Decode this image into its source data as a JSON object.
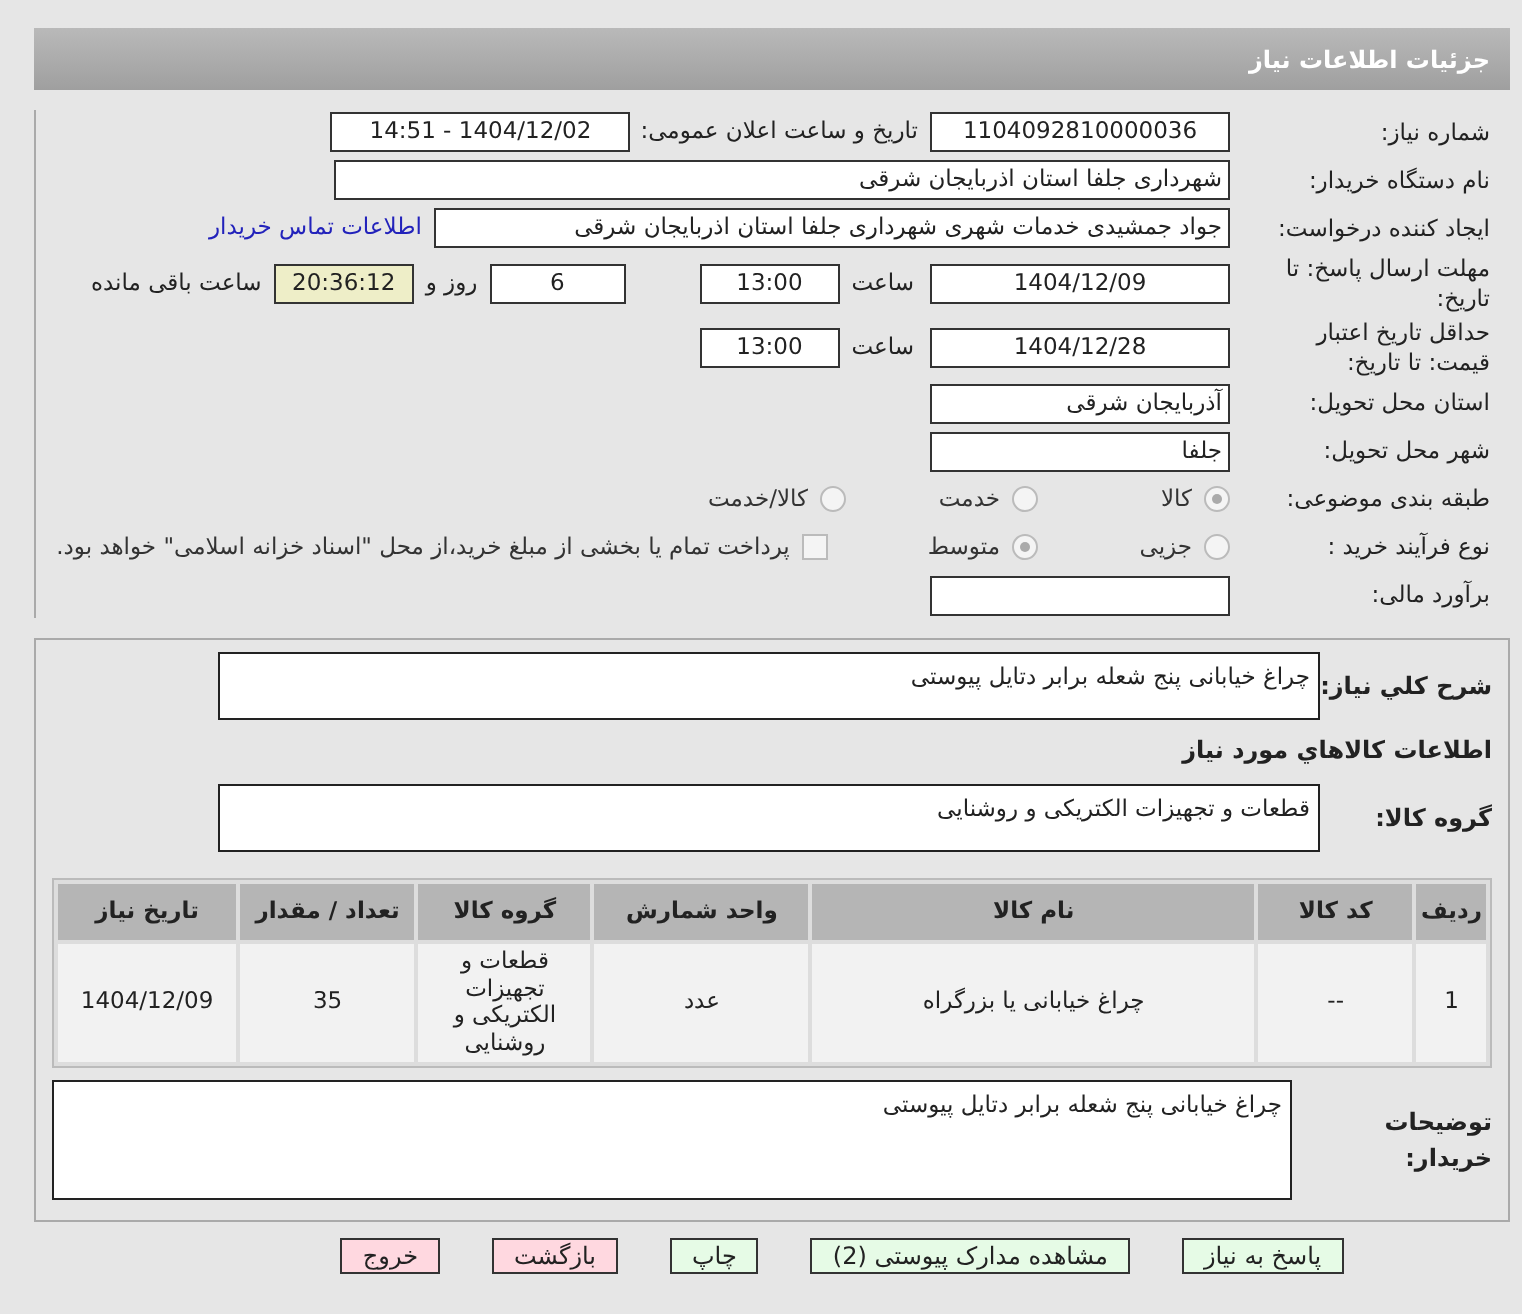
{
  "header": {
    "title": "جزئیات اطلاعات نیاز"
  },
  "need_number": {
    "label": "شماره نیاز:",
    "value": "1104092810000036"
  },
  "announce": {
    "label": "تاریخ و ساعت اعلان عمومی:",
    "value": "1404/12/02 - 14:51"
  },
  "buyer_org": {
    "label": "نام دستگاه خریدار:",
    "value": "شهرداری جلفا استان اذربایجان شرقی"
  },
  "requester": {
    "label": "ایجاد کننده درخواست:",
    "value": "جواد جمشیدی  خدمات شهری شهرداری جلفا استان اذربایجان شرقی",
    "link": "اطلاعات تماس خریدار"
  },
  "reply_deadline": {
    "label": "مهلت ارسال پاسخ: تا تاریخ:",
    "date": "1404/12/09",
    "time_label": "ساعت",
    "time": "13:00",
    "days": "6",
    "days_label": "روز و",
    "remaining": "20:36:12",
    "remaining_label": "ساعت باقی مانده"
  },
  "price_validity": {
    "label": "حداقل تاریخ اعتبار قیمت: تا تاریخ:",
    "date": "1404/12/28",
    "time_label": "ساعت",
    "time": "13:00"
  },
  "province": {
    "label": "استان محل تحویل:",
    "value": "آذربایجان شرقی"
  },
  "city": {
    "label": "شهر محل تحویل:",
    "value": "جلفا"
  },
  "category": {
    "label": "طبقه بندی موضوعی:",
    "options": [
      {
        "label": "کالا",
        "selected": true
      },
      {
        "label": "خدمت",
        "selected": false
      },
      {
        "label": "کالا/خدمت",
        "selected": false
      }
    ]
  },
  "process": {
    "label": "نوع فرآیند خرید :",
    "options": [
      {
        "label": "جزیی",
        "selected": false
      },
      {
        "label": "متوسط",
        "selected": true
      }
    ],
    "payment_checkbox": {
      "checked": false,
      "label": "پرداخت تمام یا بخشی از مبلغ خرید،از محل \"اسناد خزانه اسلامی\" خواهد بود."
    }
  },
  "estimate": {
    "label": "برآورد مالی:"
  },
  "summary": {
    "label": "شرح کلي نیاز:",
    "value": "چراغ خیابانی پنج شعله برابر دتایل پیوستی"
  },
  "goods_heading": "اطلاعات کالاهاي مورد نیاز",
  "goods_group": {
    "label": "گروه کالا:",
    "value": "قطعات و تجهیزات الکتریکی و روشنایی"
  },
  "table": {
    "columns": [
      "ردیف",
      "کد کالا",
      "نام کالا",
      "واحد شمارش",
      "گروه کالا",
      "تعداد / مقدار",
      "تاریخ نیاز"
    ],
    "rows": [
      [
        "1",
        "--",
        "چراغ خیابانی یا بزرگراه",
        "عدد",
        "قطعات و تجهیزات الکتریکی و روشنایی",
        "35",
        "1404/12/09"
      ]
    ]
  },
  "buyer_notes": {
    "label": "توضیحات خریدار:",
    "value": "چراغ خیابانی پنج شعله برابر دتایل پیوستی"
  },
  "buttons": [
    {
      "label": "پاسخ به نیاز",
      "kind": "primary"
    },
    {
      "label": "مشاهده مدارک پیوستی (2)",
      "kind": "primary"
    },
    {
      "label": "چاپ",
      "kind": "primary"
    },
    {
      "label": "بازگشت",
      "kind": "danger"
    },
    {
      "label": "خروج",
      "kind": "danger"
    }
  ]
}
